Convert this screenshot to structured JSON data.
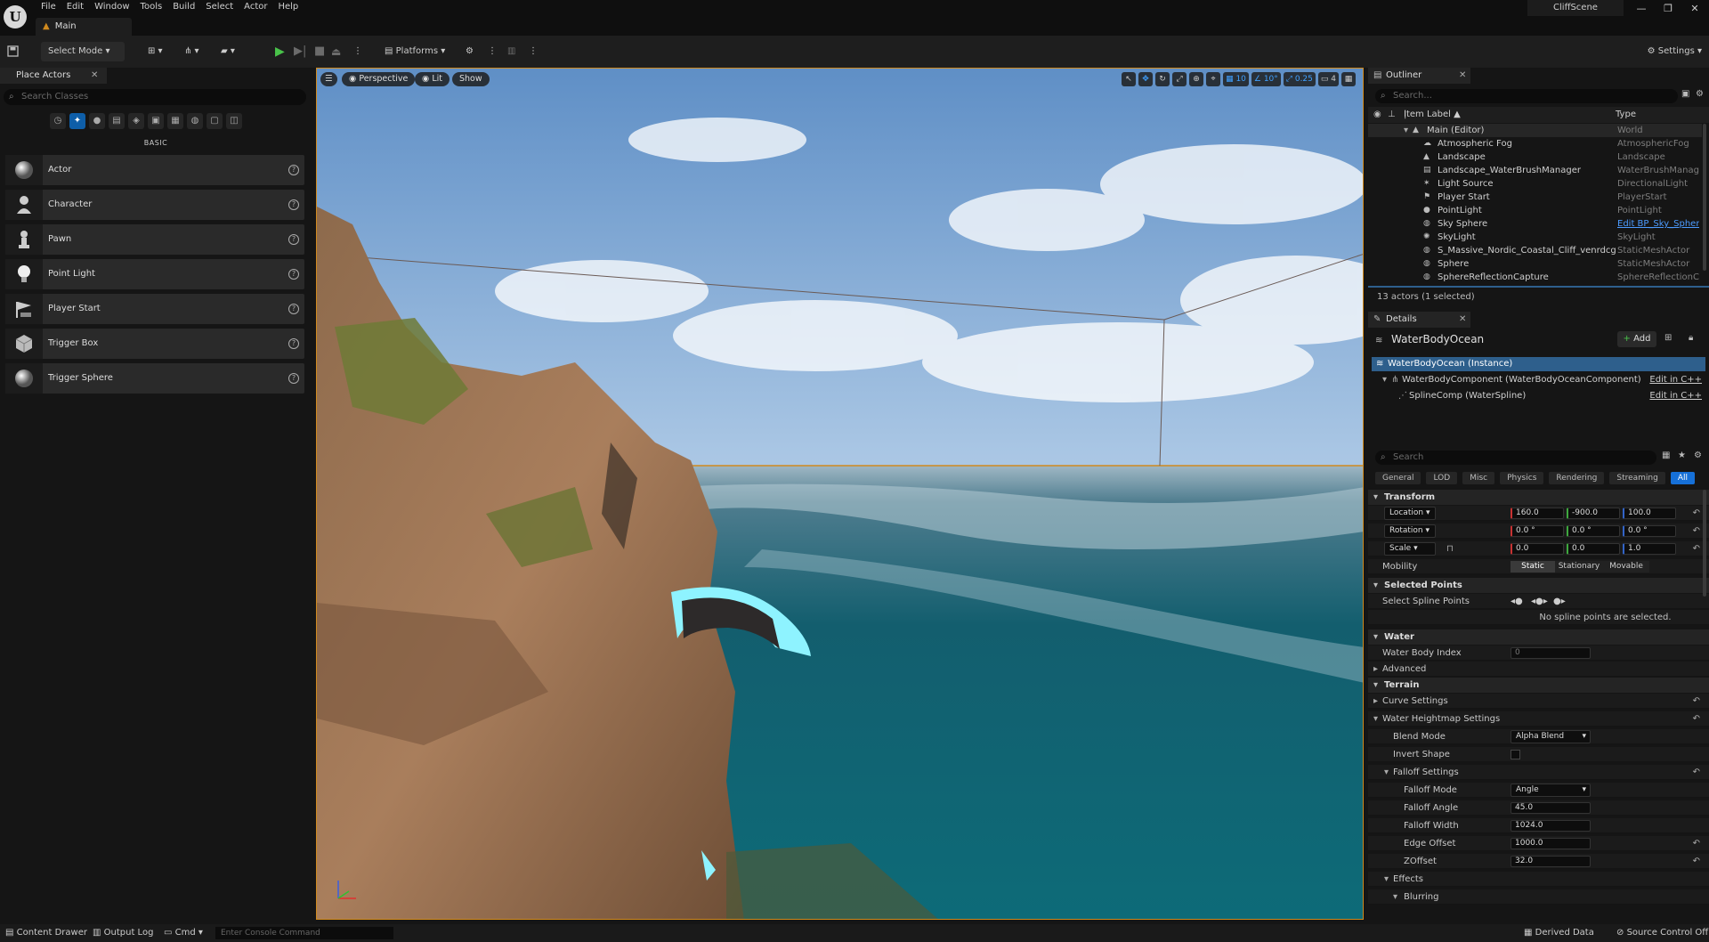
{
  "app": {
    "project": "CliffScene",
    "level_tab": "Main"
  },
  "menu": [
    "File",
    "Edit",
    "Window",
    "Tools",
    "Build",
    "Select",
    "Actor",
    "Help"
  ],
  "toolbar": {
    "select_mode": "Select Mode",
    "platforms": "Platforms",
    "settings": "Settings"
  },
  "place_actors": {
    "tab": "Place Actors",
    "search_placeholder": "Search Classes",
    "category": "BASIC",
    "items": [
      {
        "label": "Actor",
        "icon": "sphere-icon"
      },
      {
        "label": "Character",
        "icon": "character-icon"
      },
      {
        "label": "Pawn",
        "icon": "pawn-icon"
      },
      {
        "label": "Point Light",
        "icon": "lightbulb-icon"
      },
      {
        "label": "Player Start",
        "icon": "flag-icon"
      },
      {
        "label": "Trigger Box",
        "icon": "box-icon"
      },
      {
        "label": "Trigger Sphere",
        "icon": "sphere-icon"
      }
    ]
  },
  "viewport": {
    "perspective": "Perspective",
    "lit": "Lit",
    "show": "Show",
    "grid_snap": "10",
    "rot_snap": "10°",
    "scale_snap": "0.25",
    "cam_speed": "4"
  },
  "outliner": {
    "tab": "Outliner",
    "search_placeholder": "Search...",
    "col_label": "Item Label ▲",
    "col_type": "Type",
    "world": {
      "name": "Main (Editor)",
      "type": "World"
    },
    "rows": [
      {
        "name": "Atmospheric Fog",
        "type": "AtmosphericFog"
      },
      {
        "name": "Landscape",
        "type": "Landscape"
      },
      {
        "name": "Landscape_WaterBrushManager",
        "type": "WaterBrushManager"
      },
      {
        "name": "Light Source",
        "type": "DirectionalLight"
      },
      {
        "name": "Player Start",
        "type": "PlayerStart"
      },
      {
        "name": "PointLight",
        "type": "PointLight"
      },
      {
        "name": "Sky Sphere",
        "type": "Edit BP_Sky_Sphere"
      },
      {
        "name": "SkyLight",
        "type": "SkyLight"
      },
      {
        "name": "S_Massive_Nordic_Coastal_Cliff_venrdcgga_l",
        "type": "StaticMeshActor"
      },
      {
        "name": "Sphere",
        "type": "StaticMeshActor"
      },
      {
        "name": "SphereReflectionCapture",
        "type": "SphereReflectionCap"
      }
    ],
    "count": "13 actors (1 selected)"
  },
  "details": {
    "tab": "Details",
    "actor_name": "WaterBodyOcean",
    "add_label": "Add",
    "components": [
      {
        "label": "WaterBodyOcean (Instance)",
        "link": ""
      },
      {
        "label": "WaterBodyComponent (WaterBodyOceanComponent)",
        "link": "Edit in C++"
      },
      {
        "label": "SplineComp (WaterSpline)",
        "link": "Edit in C++"
      }
    ],
    "search_placeholder": "Search",
    "filter_tabs": [
      "General",
      "LOD",
      "Misc",
      "Physics",
      "Rendering",
      "Streaming",
      "All"
    ],
    "transform": {
      "title": "Transform",
      "location": {
        "label": "Location",
        "x": "160.0",
        "y": "-900.0",
        "z": "100.0"
      },
      "rotation": {
        "label": "Rotation",
        "x": "0.0 °",
        "y": "0.0 °",
        "z": "0.0 °"
      },
      "scale": {
        "label": "Scale",
        "x": "0.0",
        "y": "0.0",
        "z": "1.0"
      },
      "mobility": {
        "label": "Mobility",
        "opts": [
          "Static",
          "Stationary",
          "Movable"
        ]
      }
    },
    "selected_points": {
      "title": "Selected Points",
      "label": "Select Spline Points",
      "msg": "No spline points are selected."
    },
    "water": {
      "title": "Water",
      "index_label": "Water Body Index",
      "index_value": "0",
      "advanced": "Advanced"
    },
    "terrain": {
      "title": "Terrain",
      "curve": "Curve Settings",
      "heightmap": "Water Heightmap Settings",
      "blend_label": "Blend Mode",
      "blend_value": "Alpha Blend",
      "invert_label": "Invert Shape",
      "falloff": "Falloff Settings",
      "falloff_mode_label": "Falloff Mode",
      "falloff_mode_value": "Angle",
      "falloff_angle_label": "Falloff Angle",
      "falloff_angle_value": "45.0",
      "falloff_width_label": "Falloff Width",
      "falloff_width_value": "1024.0",
      "edge_offset_label": "Edge Offset",
      "edge_offset_value": "1000.0",
      "zoffset_label": "ZOffset",
      "zoffset_value": "32.0",
      "effects": "Effects",
      "blurring": "Blurring"
    }
  },
  "statusbar": {
    "content_drawer": "Content Drawer",
    "output_log": "Output Log",
    "cmd": "Cmd",
    "console_placeholder": "Enter Console Command",
    "derived_data": "Derived Data",
    "source_control": "Source Control Off"
  }
}
